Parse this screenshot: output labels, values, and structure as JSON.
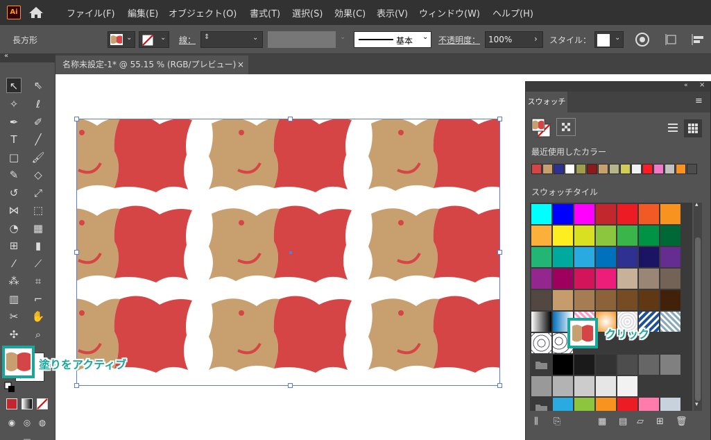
{
  "app": {
    "logo": "Ai"
  },
  "menu": [
    "ファイル(F)",
    "編集(E)",
    "オブジェクト(O)",
    "書式(T)",
    "選択(S)",
    "効果(C)",
    "表示(V)",
    "ウィンドウ(W)",
    "ヘルプ(H)"
  ],
  "control": {
    "object_type": "長方形",
    "stroke_label": "線：",
    "brush_label": "基本",
    "opacity_label": "不透明度：",
    "opacity_value": "100%",
    "style_label": "スタイル："
  },
  "document": {
    "tab_title": "名称未設定-1* @ 55.15 % (RGB/プレビュー)",
    "close": "×"
  },
  "swatches_panel": {
    "tab": "スウォッチ",
    "recent_label": "最近使用したカラー",
    "group_label": "スウォッチタイル",
    "recent_colors": [
      "#d64545",
      "#c8a06f",
      "#2e3192",
      "#ffffff",
      "#9e9e4e",
      "#8b1a1a",
      "#c8a06f",
      "#b6b48a",
      "#cfce5b",
      "#f2f2f2",
      "#ff1d25",
      "#f07ac8",
      "#c2c2c2",
      "#f7931e",
      "#4d4d4d"
    ],
    "swatch_rows": [
      [
        "#00ffff",
        "#0000ff",
        "#ff00ff",
        "#c1272d",
        "#ed1c24",
        "#f15a24",
        "#f7931e"
      ],
      [
        "#fbb03b",
        "#fcee21",
        "#d9e021",
        "#8cc63f",
        "#39b54a",
        "#009245",
        "#006837"
      ],
      [
        "#22b573",
        "#00a99d",
        "#29abe2",
        "#0071bc",
        "#2e3192",
        "#1b1464",
        "#662d91"
      ],
      [
        "#93278f",
        "#9e005d",
        "#d4145a",
        "#ed1e79",
        "#c7b299",
        "#998675",
        "#736357"
      ],
      [
        "#534741",
        "#c69c6d",
        "#a67c52",
        "#8c6239",
        "#754c24",
        "#603813",
        "#42210b"
      ]
    ],
    "gray_row1": [
      "#000000",
      "#1a1a1a",
      "#333333",
      "#4d4d4d",
      "#666666",
      "#808080"
    ],
    "gray_row2": [
      "#999999",
      "#b3b3b3",
      "#cccccc",
      "#e6e6e6",
      "#f2f2f2"
    ],
    "color_row": [
      "#29abe2",
      "#8cc63f",
      "#f7931e",
      "#ed1c24",
      "#ff7bac",
      "#c7d2dc"
    ]
  },
  "annotations": {
    "click": "クリック",
    "fill_active": "塗りをアクティブ"
  },
  "colors": {
    "pattern_red": "#d64545",
    "pattern_tan": "#c8a06f",
    "highlight": "#1aa79b"
  }
}
